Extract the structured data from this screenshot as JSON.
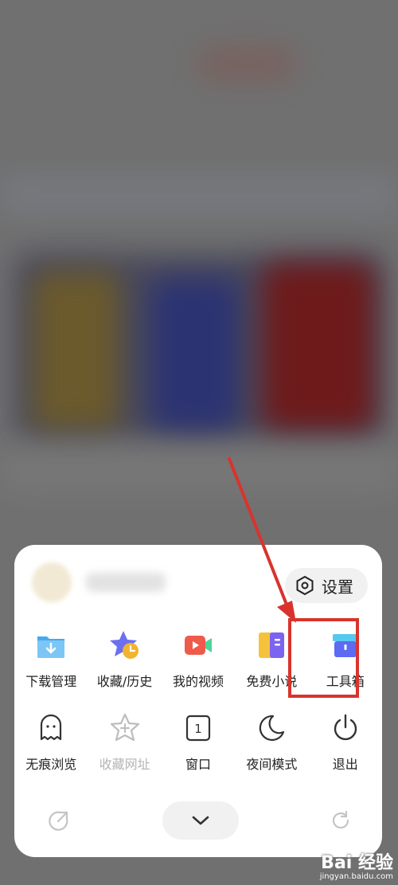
{
  "menu": {
    "settings_label": "设置",
    "row1": [
      {
        "label": "下载管理",
        "icon": "download-folder-icon"
      },
      {
        "label": "收藏/历史",
        "icon": "star-history-icon"
      },
      {
        "label": "我的视频",
        "icon": "video-camera-icon"
      },
      {
        "label": "免费小说",
        "icon": "book-icon"
      },
      {
        "label": "工具箱",
        "icon": "toolbox-icon"
      }
    ],
    "row2": [
      {
        "label": "无痕浏览",
        "icon": "ghost-icon"
      },
      {
        "label": "收藏网址",
        "icon": "star-plus-icon",
        "disabled": true
      },
      {
        "label": "窗口",
        "icon": "window-count-icon",
        "badge": "1"
      },
      {
        "label": "夜间模式",
        "icon": "moon-icon"
      },
      {
        "label": "退出",
        "icon": "power-icon"
      }
    ]
  },
  "colors": {
    "highlight": "#d8342d",
    "folder": "#47a8ef",
    "star": "#f0b42e",
    "video": "#ef5a4b",
    "book_yellow": "#f5c33b",
    "book_purple": "#7c63f0",
    "toolbox": "#5d6af2"
  },
  "watermark": {
    "main": "Bai 经验",
    "sub": "jingyan.baidu.com"
  }
}
